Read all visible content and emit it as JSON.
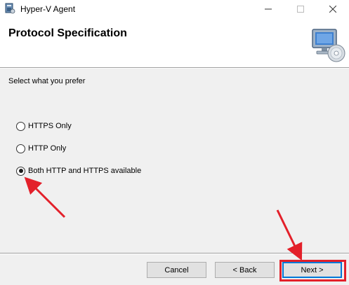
{
  "window": {
    "title": "Hyper-V Agent"
  },
  "header": {
    "title": "Protocol Specification"
  },
  "body": {
    "prompt": "Select what you prefer",
    "options": [
      {
        "label": "HTTPS Only",
        "checked": false
      },
      {
        "label": "HTTP Only",
        "checked": false
      },
      {
        "label": "Both HTTP and HTTPS available",
        "checked": true
      }
    ]
  },
  "buttons": {
    "cancel": "Cancel",
    "back": "< Back",
    "next": "Next >"
  },
  "colors": {
    "annotation_red": "#e3202a",
    "focus_blue": "#0078d7"
  },
  "icons": {
    "app": "installer-icon",
    "header": "computer-cd-icon"
  }
}
